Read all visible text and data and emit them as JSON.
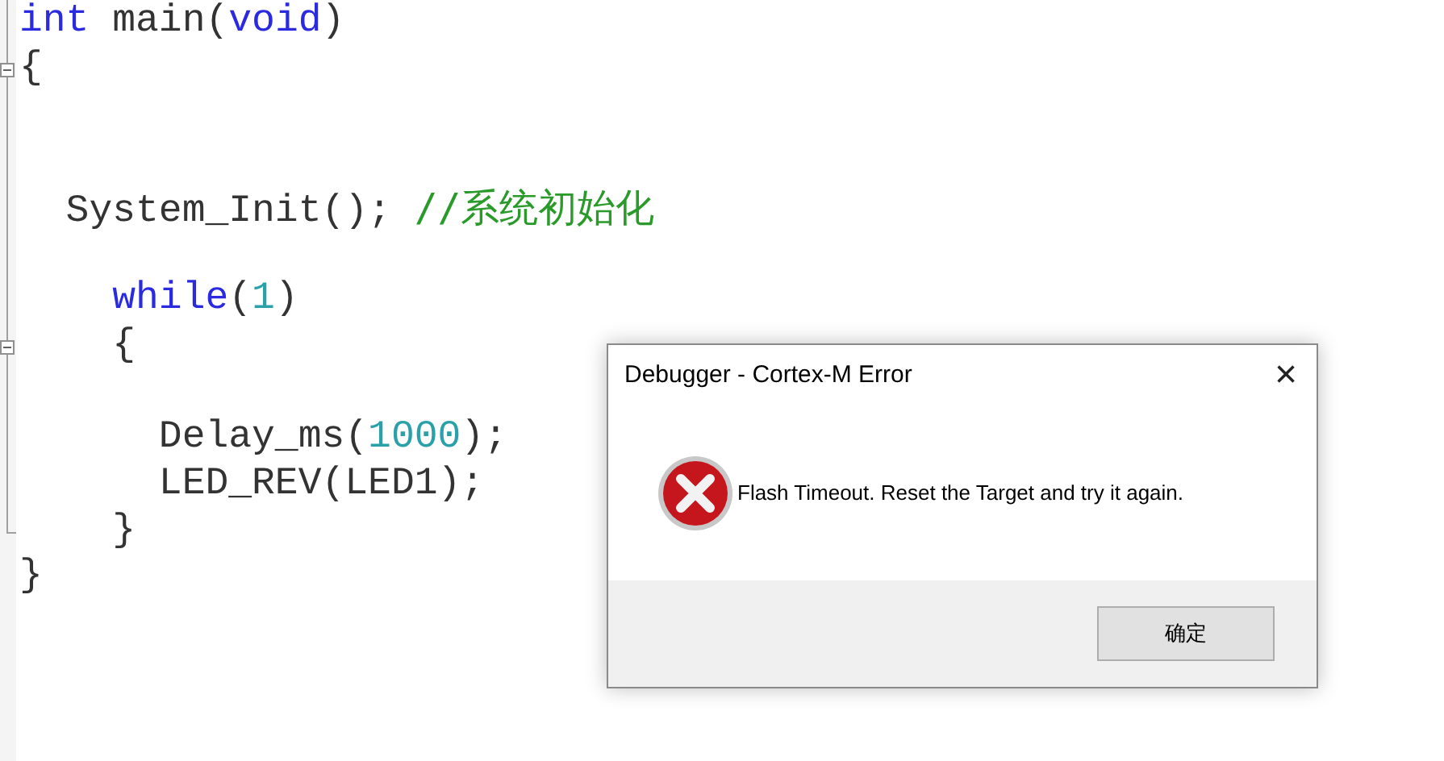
{
  "editor": {
    "lines": [
      {
        "kind": "code",
        "tokens": [
          {
            "kind": "keyword",
            "text": "int"
          },
          {
            "kind": "plain",
            "text": " main("
          },
          {
            "kind": "keyword",
            "text": "void"
          },
          {
            "kind": "plain",
            "text": ")"
          }
        ]
      },
      {
        "kind": "fold-start",
        "tokens": [
          {
            "kind": "plain",
            "text": "{"
          }
        ]
      },
      {
        "kind": "blank"
      },
      {
        "kind": "blank"
      },
      {
        "kind": "code",
        "tokens": [
          {
            "kind": "plain",
            "text": "  System_Init(); "
          },
          {
            "kind": "comment",
            "text": "//系统初始化"
          }
        ]
      },
      {
        "kind": "blank"
      },
      {
        "kind": "code",
        "tokens": [
          {
            "kind": "keyword",
            "text": "    while"
          },
          {
            "kind": "plain",
            "text": "("
          },
          {
            "kind": "number",
            "text": "1"
          },
          {
            "kind": "plain",
            "text": ")"
          }
        ]
      },
      {
        "kind": "fold-start",
        "tokens": [
          {
            "kind": "plain",
            "text": "    {"
          }
        ]
      },
      {
        "kind": "blank"
      },
      {
        "kind": "code",
        "tokens": [
          {
            "kind": "plain",
            "text": "      Delay_ms("
          },
          {
            "kind": "number",
            "text": "1000"
          },
          {
            "kind": "plain",
            "text": ");"
          }
        ]
      },
      {
        "kind": "code",
        "tokens": [
          {
            "kind": "plain",
            "text": "      LED_REV(LED1);"
          }
        ]
      },
      {
        "kind": "fold-end",
        "tokens": [
          {
            "kind": "plain",
            "text": "    }"
          }
        ]
      },
      {
        "kind": "code",
        "tokens": [
          {
            "kind": "plain",
            "text": "}"
          }
        ]
      }
    ]
  },
  "dialog": {
    "title": "Debugger - Cortex-M Error",
    "close": "×",
    "message": "Flash Timeout. Reset the Target and try it again.",
    "buttons": [
      "确定"
    ]
  }
}
